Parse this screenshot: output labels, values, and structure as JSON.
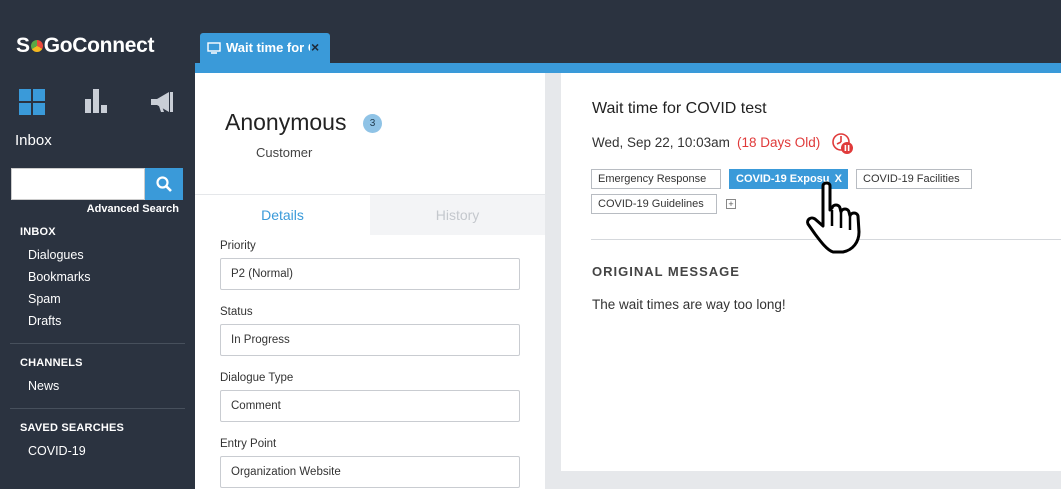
{
  "app": {
    "brand": "SoGoConnect",
    "brand_prefix": "S",
    "brand_suffix": "GoConnect"
  },
  "sidebar": {
    "inbox_heading": "Inbox",
    "search": {
      "value": "",
      "placeholder": ""
    },
    "advanced_search": "Advanced Search",
    "sections": [
      {
        "title": "INBOX",
        "items": [
          "Dialogues",
          "Bookmarks",
          "Spam",
          "Drafts"
        ]
      },
      {
        "title": "CHANNELS",
        "items": [
          "News"
        ]
      },
      {
        "title": "SAVED SEARCHES",
        "items": [
          "COVID-19"
        ]
      }
    ]
  },
  "tab": {
    "label": "Wait time for COVID test",
    "close": "×"
  },
  "contact": {
    "name": "Anonymous",
    "count": "3",
    "role": "Customer"
  },
  "detail_tabs": {
    "details": "Details",
    "history": "History"
  },
  "fields": [
    {
      "label": "Priority",
      "value": "P2 (Normal)"
    },
    {
      "label": "Status",
      "value": "In Progress"
    },
    {
      "label": "Dialogue Type",
      "value": "Comment"
    },
    {
      "label": "Entry Point",
      "value": "Organization Website"
    }
  ],
  "message": {
    "title": "Wait time for COVID test",
    "date": "Wed, Sep 22, 10:03am",
    "age": "(18 Days Old)",
    "tags": [
      "Emergency Response",
      "COVID-19 Exposu",
      "COVID-19 Facilities",
      "COVID-19 Guidelines"
    ],
    "active_tag_remove": "X",
    "add_tag": "+",
    "original_heading": "ORIGINAL MESSAGE",
    "original_text": "The wait times are way too long!"
  },
  "colors": {
    "accent": "#3a9ad9",
    "sidebar": "#2b3340",
    "alert": "#e03a3a"
  },
  "icons": [
    "dashboard-grid-icon",
    "bar-chart-icon",
    "megaphone-icon",
    "search-icon",
    "monitor-icon",
    "clock-pause-icon",
    "hand-pointer-icon"
  ]
}
